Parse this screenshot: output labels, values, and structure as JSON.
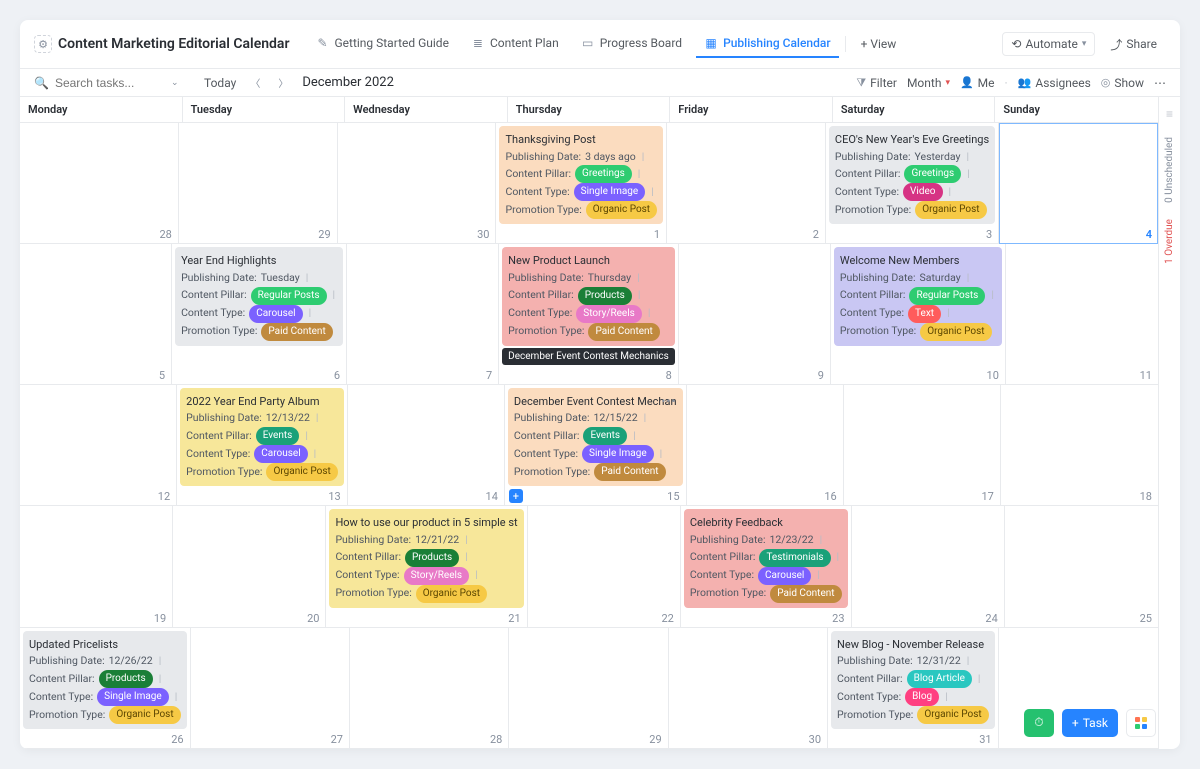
{
  "header": {
    "title": "Content Marketing Editorial Calendar",
    "tabs": [
      {
        "label": "Getting Started Guide"
      },
      {
        "label": "Content Plan"
      },
      {
        "label": "Progress Board"
      },
      {
        "label": "Publishing Calendar"
      }
    ],
    "add_view": "+ View",
    "automate": "Automate",
    "share": "Share"
  },
  "toolbar": {
    "search_placeholder": "Search tasks...",
    "today": "Today",
    "month_label": "December 2022",
    "filter": "Filter",
    "range": "Month",
    "me": "Me",
    "assignees": "Assignees",
    "show": "Show"
  },
  "day_headers": [
    "Monday",
    "Tuesday",
    "Wednesday",
    "Thursday",
    "Friday",
    "Saturday",
    "Sunday"
  ],
  "field_labels": {
    "pub": "Publishing Date:",
    "pillar": "Content Pillar:",
    "ctype": "Content Type:",
    "promo": "Promotion Type:"
  },
  "weeks": [
    {
      "days": [
        {
          "num": "28",
          "cards": []
        },
        {
          "num": "29",
          "cards": []
        },
        {
          "num": "30",
          "cards": []
        },
        {
          "num": "1",
          "cards": [
            {
              "bg": "c-orange",
              "title": "Thanksgiving Post",
              "pub": "3 days ago",
              "pillar": {
                "text": "Greetings",
                "cls": "p-greetings"
              },
              "ctype": {
                "text": "Single Image",
                "cls": "p-singleimage"
              },
              "promo": {
                "text": "Organic Post",
                "cls": "p-organic"
              }
            }
          ]
        },
        {
          "num": "2",
          "cards": []
        },
        {
          "num": "3",
          "cards": [
            {
              "bg": "c-gray",
              "title": "CEO's New Year's Eve Greetings",
              "pub": "Yesterday",
              "pillar": {
                "text": "Greetings",
                "cls": "p-greetings"
              },
              "ctype": {
                "text": "Video",
                "cls": "p-video"
              },
              "promo": {
                "text": "Organic Post",
                "cls": "p-organic"
              }
            }
          ]
        },
        {
          "num": "4",
          "today": true,
          "cards": []
        }
      ]
    },
    {
      "days": [
        {
          "num": "5",
          "cards": []
        },
        {
          "num": "6",
          "cards": [
            {
              "bg": "c-gray",
              "title": "Year End Highlights",
              "pub": "Tuesday",
              "pillar": {
                "text": "Regular Posts",
                "cls": "p-regular"
              },
              "ctype": {
                "text": "Carousel",
                "cls": "p-carousel"
              },
              "promo": {
                "text": "Paid Content",
                "cls": "p-paid"
              }
            }
          ]
        },
        {
          "num": "7",
          "cards": []
        },
        {
          "num": "8",
          "cards": [
            {
              "bg": "c-red",
              "title": "New Product Launch",
              "pub": "Thursday",
              "pillar": {
                "text": "Products",
                "cls": "p-products"
              },
              "ctype": {
                "text": "Story/Reels",
                "cls": "p-story"
              },
              "promo": {
                "text": "Paid Content",
                "cls": "p-paid"
              },
              "extra_bar": "December Event Contest Mechanics"
            }
          ]
        },
        {
          "num": "9",
          "cards": []
        },
        {
          "num": "10",
          "cards": [
            {
              "bg": "c-purple",
              "title": "Welcome New Members",
              "pub": "Saturday",
              "pillar": {
                "text": "Regular Posts",
                "cls": "p-regular"
              },
              "ctype": {
                "text": "Text",
                "cls": "p-text"
              },
              "promo": {
                "text": "Organic Post",
                "cls": "p-organic"
              }
            }
          ]
        },
        {
          "num": "11",
          "cards": []
        }
      ]
    },
    {
      "days": [
        {
          "num": "12",
          "cards": []
        },
        {
          "num": "13",
          "cards": [
            {
              "bg": "c-yellow",
              "title": "2022 Year End Party Album",
              "pub": "12/13/22",
              "pillar": {
                "text": "Events",
                "cls": "p-events"
              },
              "ctype": {
                "text": "Carousel",
                "cls": "p-carousel"
              },
              "promo": {
                "text": "Organic Post",
                "cls": "p-organic"
              }
            }
          ]
        },
        {
          "num": "14",
          "cards": []
        },
        {
          "num": "15",
          "show_add": true,
          "cards": [
            {
              "bg": "c-orange",
              "title": "December Event Contest Mechan",
              "dots": true,
              "pub": "12/15/22",
              "pillar": {
                "text": "Events",
                "cls": "p-events"
              },
              "ctype": {
                "text": "Single Image",
                "cls": "p-singleimage"
              },
              "promo": {
                "text": "Paid Content",
                "cls": "p-paid"
              }
            }
          ]
        },
        {
          "num": "16",
          "cards": []
        },
        {
          "num": "17",
          "cards": []
        },
        {
          "num": "18",
          "cards": []
        }
      ]
    },
    {
      "days": [
        {
          "num": "19",
          "cards": []
        },
        {
          "num": "20",
          "cards": []
        },
        {
          "num": "21",
          "cards": [
            {
              "bg": "c-yellow",
              "title": "How to use our product in 5 simple st",
              "pub": "12/21/22",
              "pillar": {
                "text": "Products",
                "cls": "p-products"
              },
              "ctype": {
                "text": "Story/Reels",
                "cls": "p-story"
              },
              "promo": {
                "text": "Organic Post",
                "cls": "p-organic"
              }
            }
          ]
        },
        {
          "num": "22",
          "cards": []
        },
        {
          "num": "23",
          "cards": [
            {
              "bg": "c-red",
              "title": "Celebrity Feedback",
              "pub": "12/23/22",
              "pillar": {
                "text": "Testimonials",
                "cls": "p-testimonials"
              },
              "ctype": {
                "text": "Carousel",
                "cls": "p-carousel"
              },
              "promo": {
                "text": "Paid Content",
                "cls": "p-paid"
              }
            }
          ]
        },
        {
          "num": "24",
          "cards": []
        },
        {
          "num": "25",
          "cards": []
        }
      ]
    },
    {
      "days": [
        {
          "num": "26",
          "cards": [
            {
              "bg": "c-gray",
              "title": "Updated Pricelists",
              "pub": "12/26/22",
              "pillar": {
                "text": "Products",
                "cls": "p-products"
              },
              "ctype": {
                "text": "Single Image",
                "cls": "p-singleimage"
              },
              "promo": {
                "text": "Organic Post",
                "cls": "p-organic"
              }
            }
          ]
        },
        {
          "num": "27",
          "cards": []
        },
        {
          "num": "28",
          "cards": []
        },
        {
          "num": "29",
          "cards": []
        },
        {
          "num": "30",
          "cards": []
        },
        {
          "num": "31",
          "cards": [
            {
              "bg": "c-gray",
              "title": "New Blog - November Release",
              "pub": "12/31/22",
              "pillar": {
                "text": "Blog Article",
                "cls": "p-blogarticle"
              },
              "ctype": {
                "text": "Blog",
                "cls": "p-blog"
              },
              "promo": {
                "text": "Organic Post",
                "cls": "p-organic"
              }
            }
          ]
        },
        {
          "num": "",
          "cards": []
        }
      ]
    }
  ],
  "rail": {
    "unscheduled": "0 Unscheduled",
    "overdue": "1 Overdue"
  },
  "float": {
    "task": "Task"
  }
}
